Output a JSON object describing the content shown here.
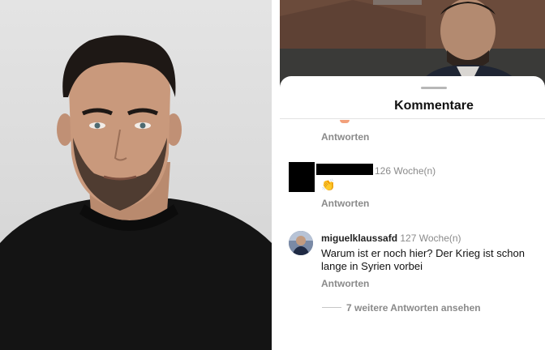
{
  "sheet": {
    "title": "Kommentare"
  },
  "comments": [
    {
      "reply_label": "Antworten"
    },
    {
      "time": "126 Woche(n)",
      "text": "👏",
      "reply_label": "Antworten"
    },
    {
      "username": "miguelklaussafd",
      "time": "127 Woche(n)",
      "text_line1": "Warum ist er noch hier? Der Krieg ist schon",
      "text_line2": "lange in Syrien vorbei",
      "reply_label": "Antworten",
      "more_replies": "7 weitere Antworten ansehen"
    }
  ],
  "colors": {
    "text_primary": "#111111",
    "text_secondary": "#8a8a8a",
    "redaction": "#000000",
    "sheet_background": "#ffffff"
  },
  "icons": [
    "clapping-hands-icon",
    "avatar-image"
  ]
}
